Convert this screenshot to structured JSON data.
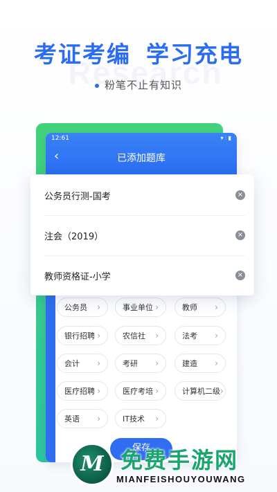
{
  "hero": {
    "title_left": "考证考编",
    "title_right": "学习充电",
    "subtitle": "粉笔不止有知识",
    "watermark": "Research"
  },
  "status": {
    "time": "12:61",
    "icons": "▾ ⫶ ▮"
  },
  "appbar": {
    "back": "‹",
    "title": "已添加题库"
  },
  "added_banks": [
    {
      "label": "公务员行测-国考"
    },
    {
      "label": "注会（2019）"
    },
    {
      "label": "教师资格证-小学"
    }
  ],
  "remove_glyph": "×",
  "chevron_glyph": "›",
  "categories": [
    {
      "label": "公务员"
    },
    {
      "label": "事业单位"
    },
    {
      "label": "教师"
    },
    {
      "label": "银行招聘"
    },
    {
      "label": "农信社"
    },
    {
      "label": "法考"
    },
    {
      "label": "会计"
    },
    {
      "label": "考研"
    },
    {
      "label": "建造"
    },
    {
      "label": "医疗招聘"
    },
    {
      "label": "医疗考培"
    },
    {
      "label": "计算机二级"
    },
    {
      "label": "英语"
    },
    {
      "label": "IT技术"
    }
  ],
  "save_label": "保存",
  "brand": {
    "logo_letter": "M",
    "name": "免费手游网",
    "url": "MIANFEISHOUYOUWANG"
  },
  "colors": {
    "primary": "#2a6cf2",
    "green": "#43d27a",
    "brand_green": "#1aa56e"
  }
}
